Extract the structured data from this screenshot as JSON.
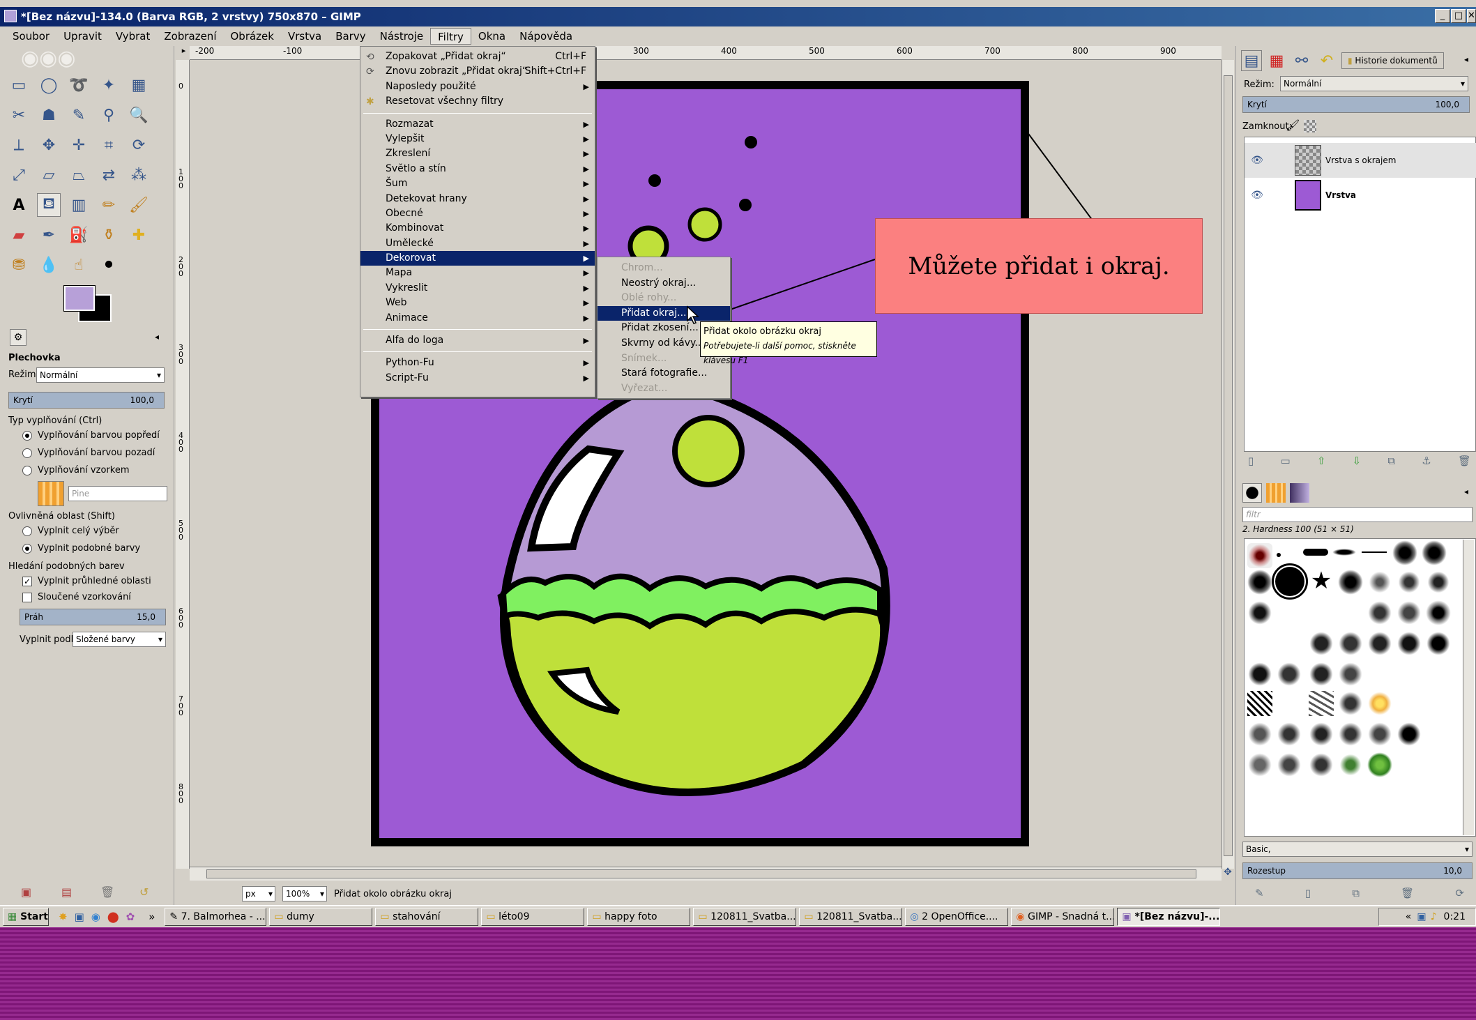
{
  "window": {
    "title": "*[Bez názvu]-134.0 (Barva RGB, 2 vrstvy) 750x870 – GIMP"
  },
  "menubar": [
    "Soubor",
    "Upravit",
    "Vybrat",
    "Zobrazení",
    "Obrázek",
    "Vrstva",
    "Barvy",
    "Nástroje",
    "Filtry",
    "Okna",
    "Nápověda"
  ],
  "filters_menu": {
    "repeat": {
      "label": "Zopakovat „Přidat okraj“",
      "shortcut": "Ctrl+F"
    },
    "reshow": {
      "label": "Znovu zobrazit „Přidat okraj“",
      "shortcut": "Shift+Ctrl+F"
    },
    "recent": "Naposledy použité",
    "reset": "Resetovat všechny filtry",
    "categories": [
      "Rozmazat",
      "Vylepšit",
      "Zkreslení",
      "Světlo a stín",
      "Šum",
      "Detekovat hrany",
      "Obecné",
      "Kombinovat",
      "Umělecké",
      "Dekorovat",
      "Mapa",
      "Vykreslit",
      "Web",
      "Animace"
    ],
    "alpha_to_logo": "Alfa do loga",
    "python_fu": "Python-Fu",
    "script_fu": "Script-Fu"
  },
  "decor_menu": [
    {
      "label": "Chrom...",
      "disabled": true
    },
    {
      "label": "Neostrý okraj...",
      "disabled": false
    },
    {
      "label": "Oblé rohy...",
      "disabled": true
    },
    {
      "label": "Přidat okraj...",
      "disabled": false,
      "highlighted": true
    },
    {
      "label": "Přidat zkosení...",
      "disabled": false
    },
    {
      "label": "Skvrny od kávy...",
      "disabled": false
    },
    {
      "label": "Snímek...",
      "disabled": true
    },
    {
      "label": "Stará fotografie...",
      "disabled": false
    },
    {
      "label": "Vyřezat...",
      "disabled": true
    }
  ],
  "tooltip": {
    "title": "Přidat okolo obrázku okraj",
    "help": "Potřebujete-li další pomoc, stiskněte klávesu F1"
  },
  "callout": "Můžete přidat i okraj.",
  "tool_options": {
    "title": "Plechovka",
    "mode_label": "Režim:",
    "mode_value": "Normální",
    "opacity_label": "Krytí",
    "opacity_value": "100,0",
    "fill_type_label": "Typ vyplňování  (Ctrl)",
    "fill_fg": "Vyplňování barvou popředí",
    "fill_bg": "Vyplňování barvou pozadí",
    "fill_pattern": "Vyplňování vzorkem",
    "pattern_name": "Pine",
    "affected_label": "Ovlivněná oblast  (Shift)",
    "fill_selection": "Vyplnit celý výběr",
    "fill_similar": "Vyplnit podobné barvy",
    "similar_label": "Hledání podobných barev",
    "fill_transparent": "Vyplnit průhledné oblasti",
    "sample_merged": "Sloučené vzorkování",
    "threshold_label": "Práh",
    "threshold_value": "15,0",
    "fill_by_label": "Vyplnit podle:",
    "fill_by_value": "Složené barvy"
  },
  "ruler": {
    "top": [
      "-200",
      "-100",
      "300",
      "400",
      "500",
      "600",
      "700",
      "800",
      "900"
    ],
    "left": [
      "0",
      "1 0 0",
      "2 0 0",
      "3 0 0",
      "4 0 0",
      "5 0 0",
      "6 0 0",
      "7 0 0",
      "8 0 0"
    ]
  },
  "statusbar": {
    "unit": "px",
    "zoom": "100%",
    "message": "Přidat okolo obrázku okraj"
  },
  "layers_dock": {
    "tab_label": "Historie dokumentů",
    "mode_label": "Režim:",
    "mode_value": "Normální",
    "opacity_label": "Krytí",
    "opacity_value": "100,0",
    "lock_label": "Zamknout:",
    "layers": [
      "Vrstva s okrajem",
      "Vrstva"
    ]
  },
  "brushes_dock": {
    "filter_placeholder": "filtr",
    "brush_name": "2. Hardness 100 (51 × 51)",
    "preset": "Basic,",
    "spacing_label": "Rozestup",
    "spacing_value": "10,0"
  },
  "taskbar": {
    "start": "Start",
    "items": [
      "7. Balmorhea - ...",
      "dumy",
      "stahování",
      "léto09",
      "happy foto",
      "120811_Svatba...",
      "120811_Svatba...",
      "2 OpenOffice....",
      "GIMP - Snadná t...",
      "*[Bez názvu]-..."
    ],
    "clock": "0:21"
  },
  "colors": {
    "canvas_fill": "#9d5ad4",
    "callout_bg": "#fb8080",
    "menu_highlight": "#0a246a",
    "flask_liquid": "#bfe03a",
    "flask_wave": "#80f060",
    "flask_glass": "#b69ad4"
  }
}
